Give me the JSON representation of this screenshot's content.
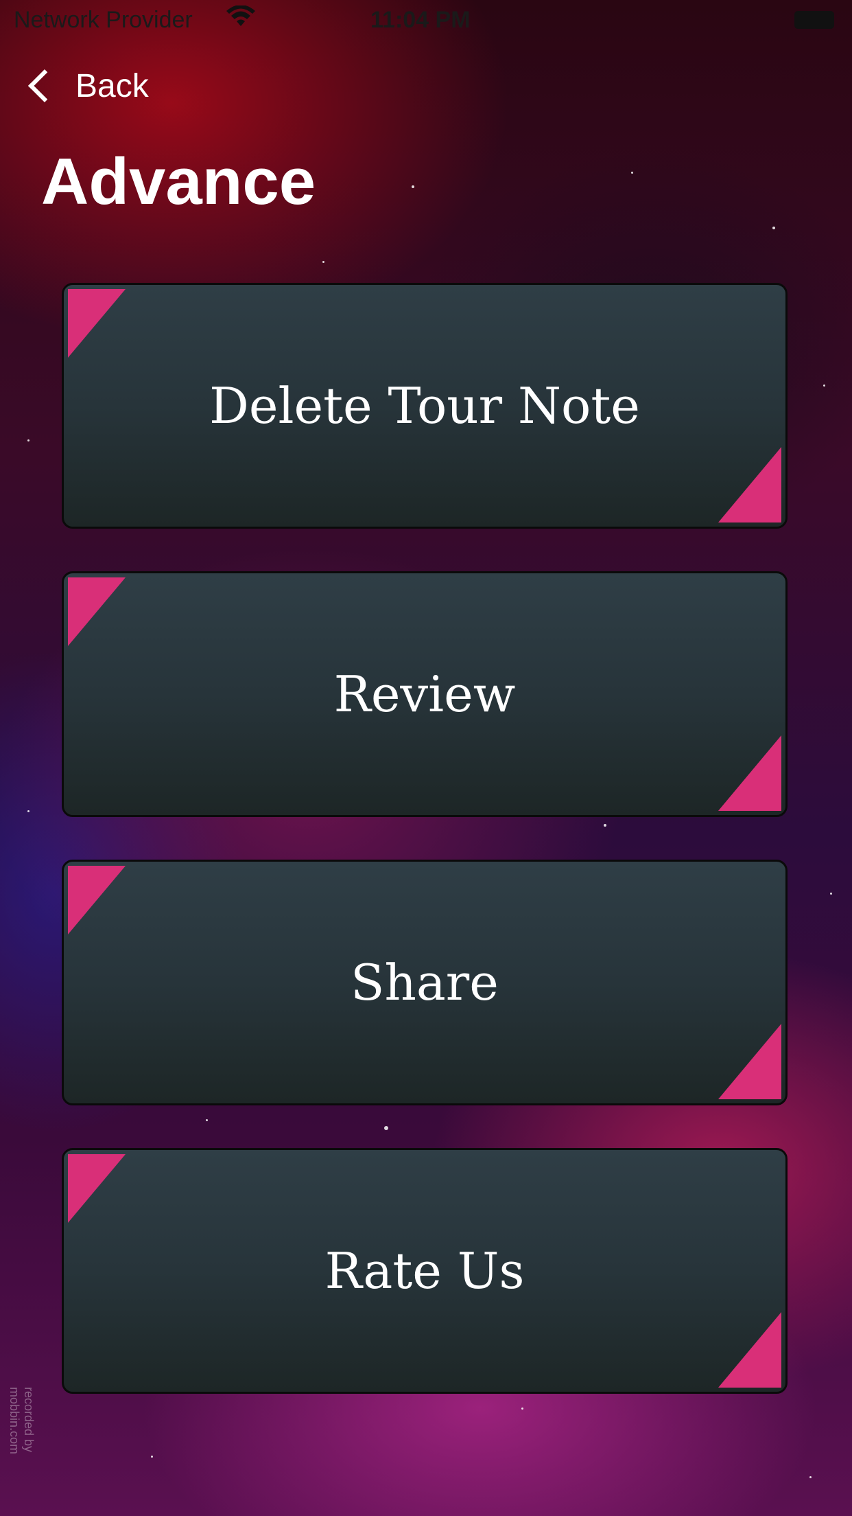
{
  "status_bar": {
    "carrier": "Network Provider",
    "time": "11:04 PM",
    "wifi_icon": "wifi-icon",
    "battery_icon": "battery-icon"
  },
  "nav": {
    "back_label": "Back"
  },
  "page": {
    "title": "Advance"
  },
  "menu": {
    "items": [
      {
        "label": "Delete Tour Note"
      },
      {
        "label": "Review"
      },
      {
        "label": "Share"
      },
      {
        "label": "Rate Us"
      }
    ]
  },
  "watermark": "recorded by mobbin.com",
  "colors": {
    "accent": "#d92f78",
    "button_top": "#2f3e46",
    "button_bottom": "#1d2626"
  }
}
